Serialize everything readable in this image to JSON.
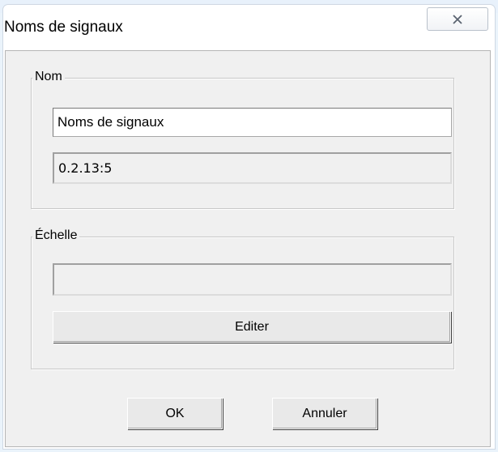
{
  "window": {
    "title": "Noms de signaux",
    "close_icon": "close-x-icon"
  },
  "nom_group": {
    "label": "Nom",
    "name_field": "Noms de signaux",
    "address_field": "0.2.13:5"
  },
  "echelle_group": {
    "label": "Échelle",
    "scale_field": "",
    "edit_button": "Editer"
  },
  "buttons": {
    "ok": "OK",
    "cancel": "Annuler"
  }
}
